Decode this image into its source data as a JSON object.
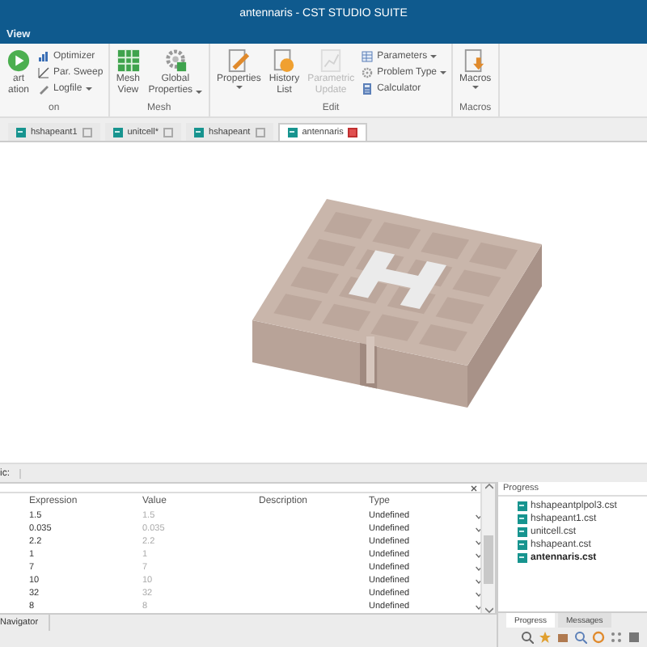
{
  "window": {
    "title": "antennaris - CST STUDIO SUITE"
  },
  "menu": [
    {
      "label": "View"
    }
  ],
  "ribbon": [
    {
      "label": "on",
      "items": [
        {
          "kind": "large",
          "lines": [
            "art",
            "ation"
          ],
          "menu": false,
          "disabled": false
        },
        {
          "kind": "column",
          "entries": [
            {
              "label": "Optimizer",
              "menu": false
            },
            {
              "label": "Par. Sweep",
              "menu": false
            },
            {
              "label": "Logfile",
              "menu": true
            }
          ]
        }
      ]
    },
    {
      "label": "Mesh",
      "items": [
        {
          "kind": "large",
          "lines": [
            "Mesh",
            "View"
          ],
          "menu": false,
          "disabled": false
        },
        {
          "kind": "large",
          "lines": [
            "Global",
            "Properties"
          ],
          "menu": true,
          "disabled": false
        }
      ]
    },
    {
      "label": "Edit",
      "items": [
        {
          "kind": "large",
          "lines": [
            "Properties"
          ],
          "menu": true,
          "disabled": false
        },
        {
          "kind": "large",
          "lines": [
            "History",
            "List"
          ],
          "menu": false,
          "disabled": false
        },
        {
          "kind": "large",
          "lines": [
            "Parametric",
            "Update"
          ],
          "menu": false,
          "disabled": true
        },
        {
          "kind": "column",
          "entries": [
            {
              "label": "Parameters",
              "menu": true
            },
            {
              "label": "Problem Type",
              "menu": true
            },
            {
              "label": "Calculator",
              "menu": false
            }
          ]
        }
      ]
    },
    {
      "label": "Macros",
      "items": [
        {
          "kind": "large",
          "lines": [
            "Macros"
          ],
          "menu": true,
          "disabled": false
        }
      ]
    }
  ],
  "tabs": [
    {
      "label": "hshapeant1",
      "selected": false
    },
    {
      "label": "unitcell*",
      "selected": false
    },
    {
      "label": "hshapeant",
      "selected": false
    },
    {
      "label": "antennaris",
      "selected": true
    }
  ],
  "pane_header": "ic:",
  "table": {
    "columns": [
      "Expression",
      "Value",
      "Description",
      "Type"
    ],
    "rows": [
      {
        "expression": "1.5",
        "value": "1.5",
        "type": "Undefined"
      },
      {
        "expression": "0.035",
        "value": "0.035",
        "type": "Undefined"
      },
      {
        "expression": "2.2",
        "value": "2.2",
        "type": "Undefined"
      },
      {
        "expression": "1",
        "value": "1",
        "type": "Undefined"
      },
      {
        "expression": "7",
        "value": "7",
        "type": "Undefined"
      },
      {
        "expression": "10",
        "value": "10",
        "type": "Undefined"
      },
      {
        "expression": "32",
        "value": "32",
        "type": "Undefined"
      },
      {
        "expression": "8",
        "value": "8",
        "type": "Undefined"
      }
    ]
  },
  "navigator_tab": "Navigator",
  "progress": {
    "title": "Progress",
    "files": [
      {
        "name": "hshapeantplpol3.cst",
        "active": false
      },
      {
        "name": "hshapeant1.cst",
        "active": false
      },
      {
        "name": "unitcell.cst",
        "active": false
      },
      {
        "name": "hshapeant.cst",
        "active": false
      },
      {
        "name": "antennaris.cst",
        "active": true
      }
    ],
    "tabs": [
      {
        "label": "Progress",
        "selected": true
      },
      {
        "label": "Messages",
        "selected": false
      }
    ]
  }
}
